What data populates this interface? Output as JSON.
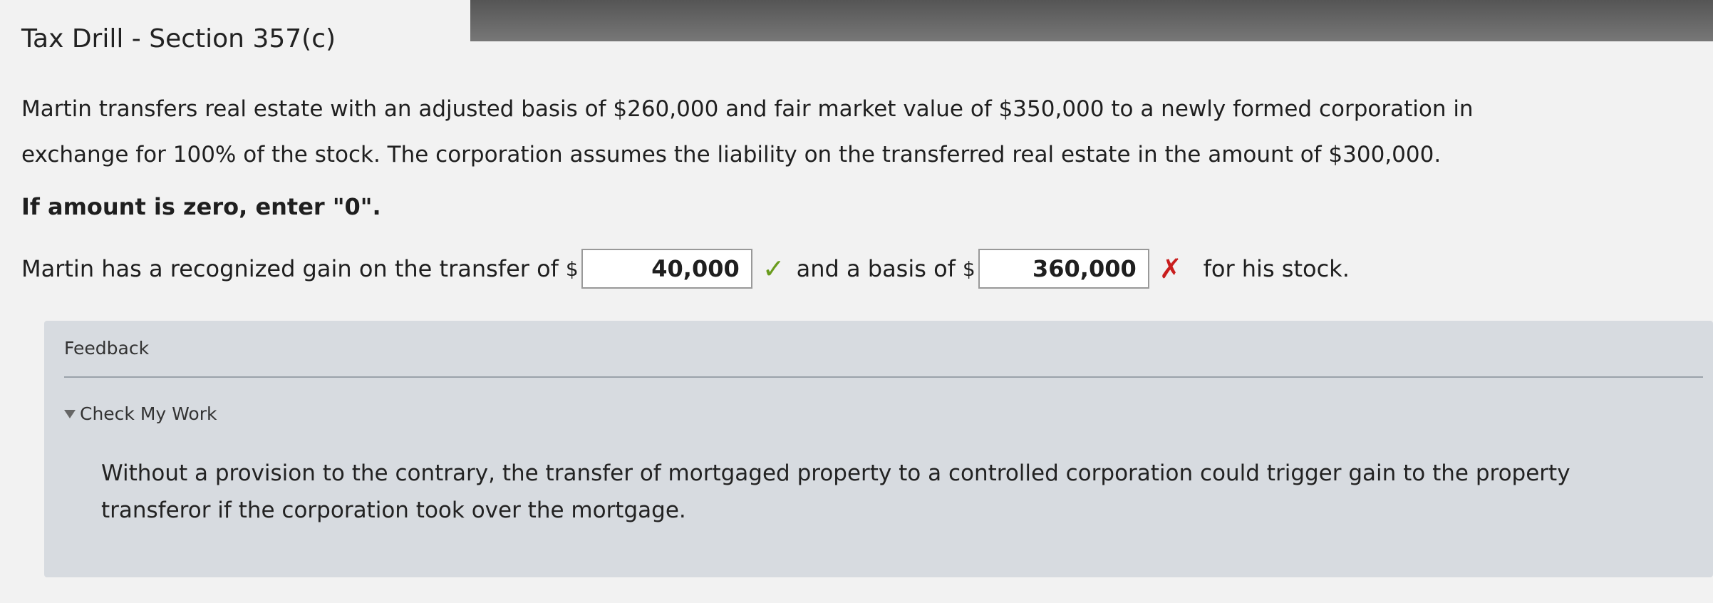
{
  "title": "Tax Drill - Section 357(c)",
  "problem_text": "Martin transfers real estate with an adjusted basis of $260,000 and fair market value of $350,000 to a newly formed corporation in exchange for 100% of the stock. The corporation assumes the liability on the transferred real estate in the amount of $300,000.",
  "instruction": "If amount is zero, enter \"0\".",
  "answer": {
    "prefix": "Martin has a recognized gain on the transfer of",
    "currency": "$",
    "gain_value": "40,000",
    "gain_mark": "✓",
    "middle": "and a basis of",
    "basis_value": "360,000",
    "basis_mark": "✗",
    "suffix": "for his stock."
  },
  "feedback": {
    "label": "Feedback",
    "check_my_work": "Check My Work",
    "explanation": "Without a provision to the contrary, the transfer of mortgaged property to a controlled corporation could trigger gain to the property transferor if the corporation took over the mortgage."
  },
  "colors": {
    "correct": "#6a9c1e",
    "incorrect": "#c91e1e"
  }
}
